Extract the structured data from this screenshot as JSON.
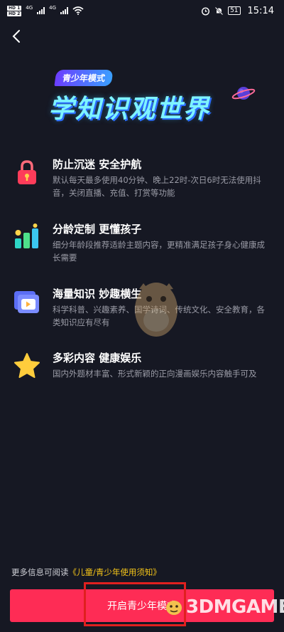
{
  "status_bar": {
    "sim1": "HD 1",
    "sim2": "HD 2",
    "net1": "4G",
    "net2": "4G",
    "battery": "51",
    "time": "15:14"
  },
  "banner": {
    "tag": "青少年模式",
    "title": "学知识观世界"
  },
  "features": [
    {
      "icon": "lock-icon",
      "title": "防止沉迷 安全护航",
      "desc": "默认每天最多使用40分钟、晚上22时-次日6时无法使用抖音，关闭直播、充值、打赏等功能"
    },
    {
      "icon": "bar-chart-icon",
      "title": "分龄定制 更懂孩子",
      "desc": "细分年龄段推荐适龄主题内容，更精准满足孩子身心健康成长需要"
    },
    {
      "icon": "video-folder-icon",
      "title": "海量知识 妙趣横生",
      "desc": "科学科普、兴趣素养、国学诗词、传统文化、安全教育，各类知识应有尽有"
    },
    {
      "icon": "star-icon",
      "title": "多彩内容 健康娱乐",
      "desc": "国内外题材丰富、形式新颖的正向漫画娱乐内容触手可及"
    }
  ],
  "footer": {
    "more_info_prefix": "更多信息可阅读",
    "more_info_link": "《儿童/青少年使用须知》",
    "button_label": "开启青少年模式",
    "watermark": "3DMGAME"
  },
  "colors": {
    "background": "#161823",
    "primary": "#fe2c55",
    "link": "#f5c518",
    "muted_text": "#9a9ba6"
  }
}
